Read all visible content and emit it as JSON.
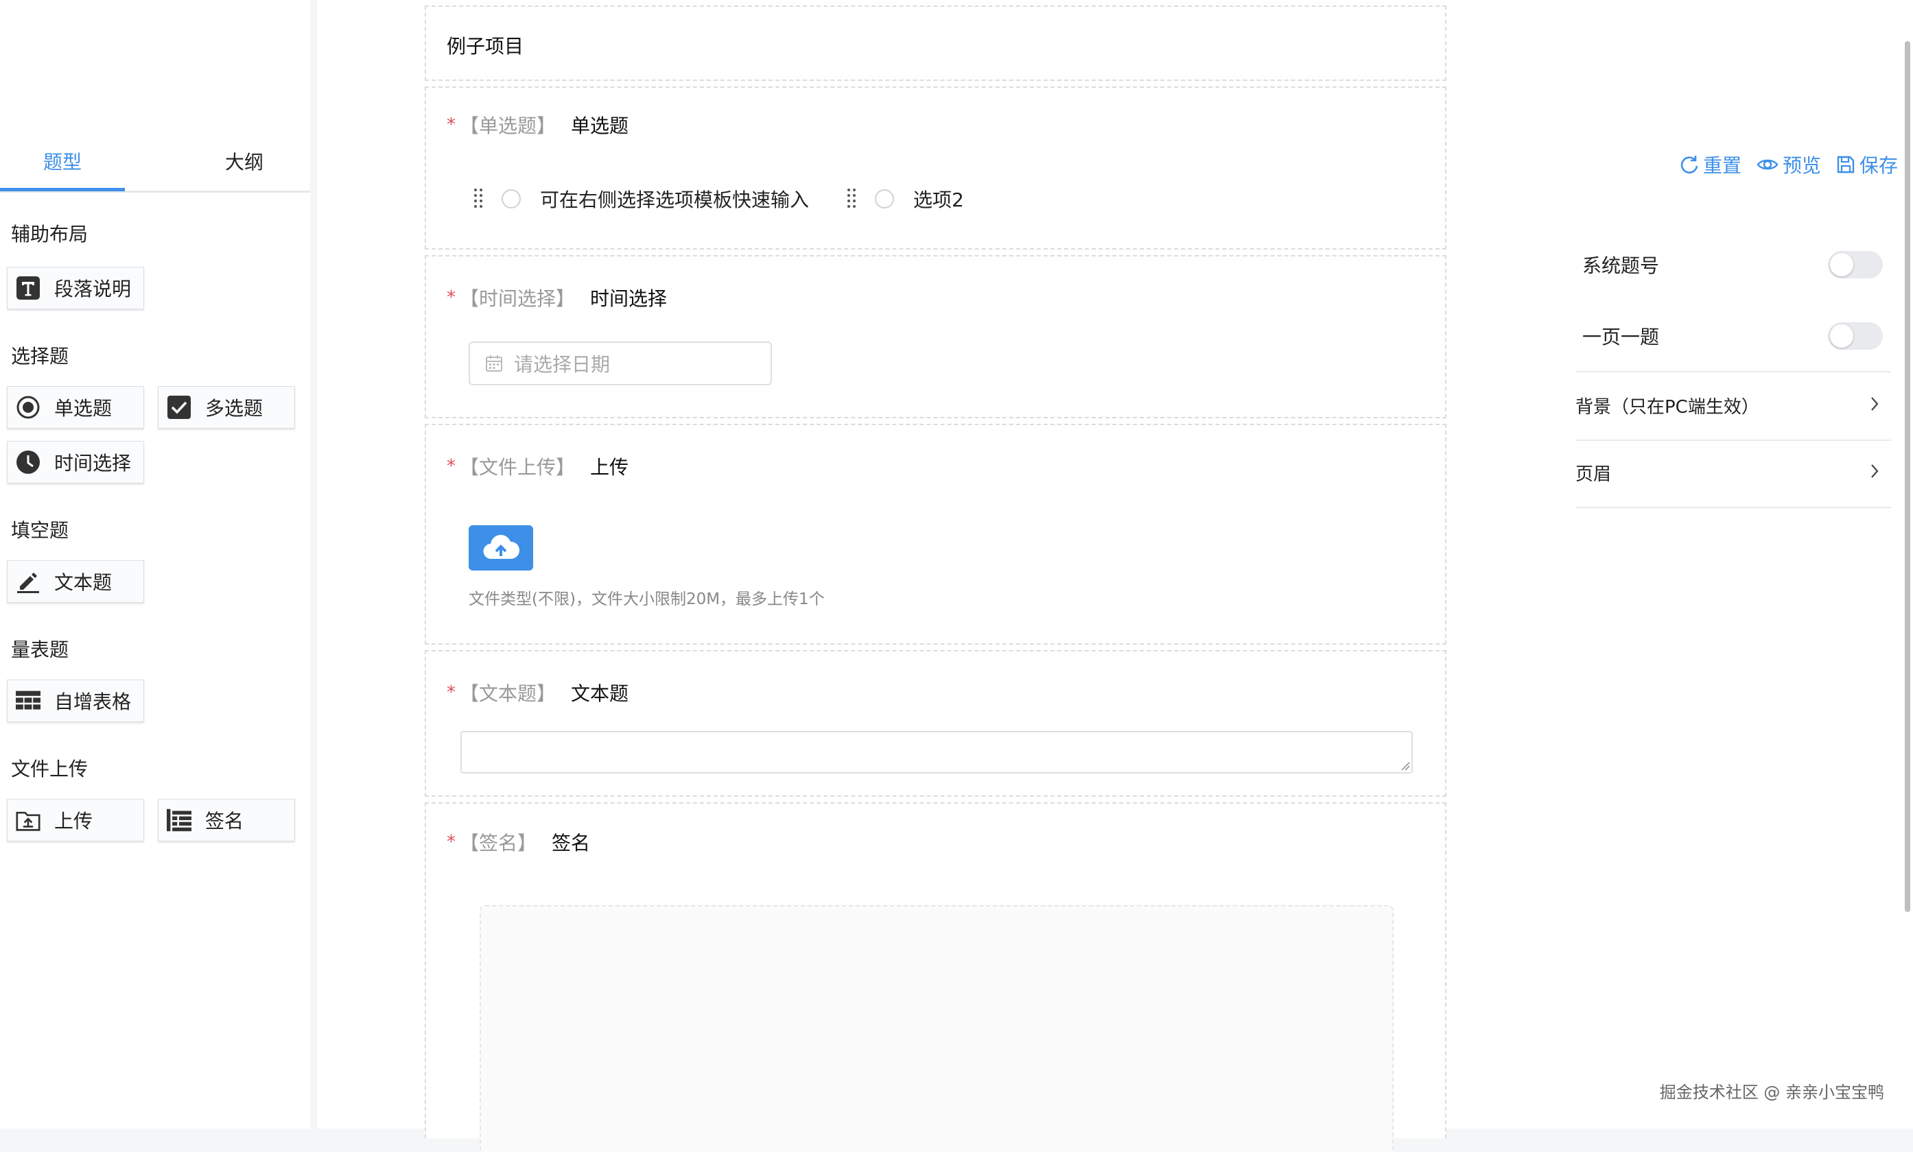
{
  "left_panel": {
    "tabs": [
      {
        "label": "题型",
        "active": true
      },
      {
        "label": "大纲",
        "active": false
      }
    ],
    "sections": [
      {
        "title": "辅助布局",
        "items": [
          {
            "label": "段落说明",
            "icon": "text-box-icon"
          }
        ]
      },
      {
        "title": "选择题",
        "items": [
          {
            "label": "单选题",
            "icon": "radio-icon"
          },
          {
            "label": "多选题",
            "icon": "checkbox-icon"
          },
          {
            "label": "时间选择",
            "icon": "clock-icon"
          }
        ]
      },
      {
        "title": "填空题",
        "items": [
          {
            "label": "文本题",
            "icon": "pencil-icon"
          }
        ]
      },
      {
        "title": "量表题",
        "items": [
          {
            "label": "自增表格",
            "icon": "table-icon"
          }
        ]
      },
      {
        "title": "文件上传",
        "items": [
          {
            "label": "上传",
            "icon": "upload-folder-icon"
          },
          {
            "label": "签名",
            "icon": "signature-icon"
          }
        ]
      }
    ]
  },
  "canvas": {
    "project_title": "例子项目",
    "questions": [
      {
        "tag": "【单选题】",
        "title": "单选题",
        "required": true,
        "options": [
          "可在右侧选择选项模板快速输入",
          "选项2"
        ]
      },
      {
        "tag": "【时间选择】",
        "title": "时间选择",
        "required": true,
        "placeholder": "请选择日期"
      },
      {
        "tag": "【文件上传】",
        "title": "上传",
        "required": true,
        "hint": "文件类型(不限)，文件大小限制20M，最多上传1个"
      },
      {
        "tag": "【文本题】",
        "title": "文本题",
        "required": true
      },
      {
        "tag": "【签名】",
        "title": "签名",
        "required": true
      }
    ],
    "required_mark": "*"
  },
  "right_panel": {
    "actions": [
      {
        "label": "重置",
        "icon": "refresh-icon"
      },
      {
        "label": "预览",
        "icon": "eye-icon"
      },
      {
        "label": "保存",
        "icon": "save-icon"
      }
    ],
    "settings": [
      {
        "label": "系统题号",
        "enabled": false
      },
      {
        "label": "一页一题",
        "enabled": false
      }
    ],
    "collapses": [
      {
        "label": "背景（只在PC端生效）"
      },
      {
        "label": "页眉"
      }
    ],
    "watermark": "掘金技术社区 @ 亲亲小宝宝鸭"
  },
  "colors": {
    "accent": "#3d8fe8",
    "required": "#e34d59",
    "border_dashed": "#dcdcdc"
  }
}
